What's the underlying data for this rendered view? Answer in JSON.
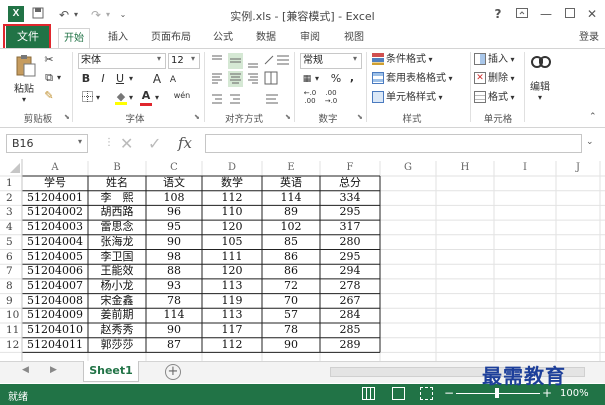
{
  "window": {
    "title": "实例.xls - [兼容模式] - Excel",
    "help": "?",
    "min": "—",
    "close": "✕",
    "signin": "登录"
  },
  "tabs": [
    "文件",
    "开始",
    "插入",
    "页面布局",
    "公式",
    "数据",
    "审阅",
    "视图"
  ],
  "ribbon": {
    "clipboard": {
      "paste": "粘贴",
      "label": "剪贴板"
    },
    "font": {
      "name": "宋体",
      "size": "12",
      "label": "字体",
      "bold": "B",
      "italic": "I",
      "underline": "U",
      "grow": "A",
      "shrink": "A",
      "color_a": "A",
      "wen": "wén"
    },
    "alignment": {
      "label": "对齐方式"
    },
    "number": {
      "format": "常规",
      "percent": "%",
      "comma": ",",
      "label": "数字"
    },
    "styles": {
      "conditional": "条件格式",
      "table": "套用表格格式",
      "cell": "单元格样式",
      "label": "样式"
    },
    "cells": {
      "insert": "插入",
      "delete": "删除",
      "format": "格式",
      "label": "单元格"
    },
    "editing": {
      "edit": "编辑"
    }
  },
  "formula_bar": {
    "name_box": "B16",
    "fx": "fx",
    "value": ""
  },
  "columns": [
    "A",
    "B",
    "C",
    "D",
    "E",
    "F",
    "G",
    "H",
    "I",
    "J"
  ],
  "rows": [
    {
      "n": "1",
      "a": "学号",
      "b": "姓名",
      "c": "语文",
      "d": "数学",
      "e": "英语",
      "f": "总分"
    },
    {
      "n": "2",
      "a": "51204001",
      "b": "李　熙",
      "c": "108",
      "d": "112",
      "e": "114",
      "f": "334"
    },
    {
      "n": "3",
      "a": "51204002",
      "b": "胡西路",
      "c": "96",
      "d": "110",
      "e": "89",
      "f": "295"
    },
    {
      "n": "4",
      "a": "51204003",
      "b": "雷思念",
      "c": "95",
      "d": "120",
      "e": "102",
      "f": "317"
    },
    {
      "n": "5",
      "a": "51204004",
      "b": "张海龙",
      "c": "90",
      "d": "105",
      "e": "85",
      "f": "280"
    },
    {
      "n": "6",
      "a": "51204005",
      "b": "李卫国",
      "c": "98",
      "d": "111",
      "e": "86",
      "f": "295"
    },
    {
      "n": "7",
      "a": "51204006",
      "b": "王能效",
      "c": "88",
      "d": "120",
      "e": "86",
      "f": "294"
    },
    {
      "n": "8",
      "a": "51204007",
      "b": "杨小龙",
      "c": "93",
      "d": "113",
      "e": "72",
      "f": "278"
    },
    {
      "n": "9",
      "a": "51204008",
      "b": "宋金鑫",
      "c": "78",
      "d": "119",
      "e": "70",
      "f": "267"
    },
    {
      "n": "10",
      "a": "51204009",
      "b": "姜前期",
      "c": "114",
      "d": "113",
      "e": "57",
      "f": "284"
    },
    {
      "n": "11",
      "a": "51204010",
      "b": "赵秀秀",
      "c": "90",
      "d": "117",
      "e": "78",
      "f": "285"
    },
    {
      "n": "12",
      "a": "51204011",
      "b": "郭莎莎",
      "c": "87",
      "d": "112",
      "e": "90",
      "f": "289"
    }
  ],
  "sheet": {
    "name": "Sheet1",
    "add": "+"
  },
  "status": {
    "ready": "就绪",
    "zoom": "100%",
    "minus": "−",
    "plus": "+"
  },
  "watermark": "最需教育",
  "colors": {
    "excel_green": "#217346",
    "highlight": "#e0262d",
    "watermark": "#1d3f9a"
  }
}
